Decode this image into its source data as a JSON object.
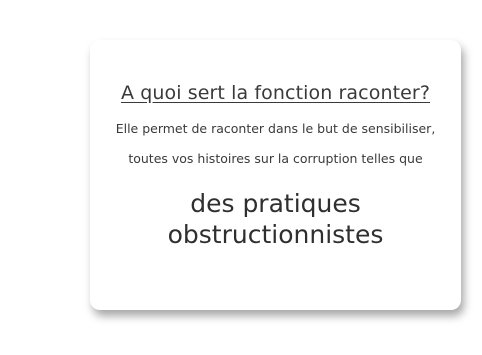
{
  "card": {
    "title": "A quoi sert la fonction raconter?",
    "description_line1": "Elle permet de raconter dans le but de sensibiliser,",
    "description_line2": "toutes vos histoires sur la corruption telles que",
    "highlight_line1": "des pratiques",
    "highlight_line2": "obstructionnistes"
  }
}
